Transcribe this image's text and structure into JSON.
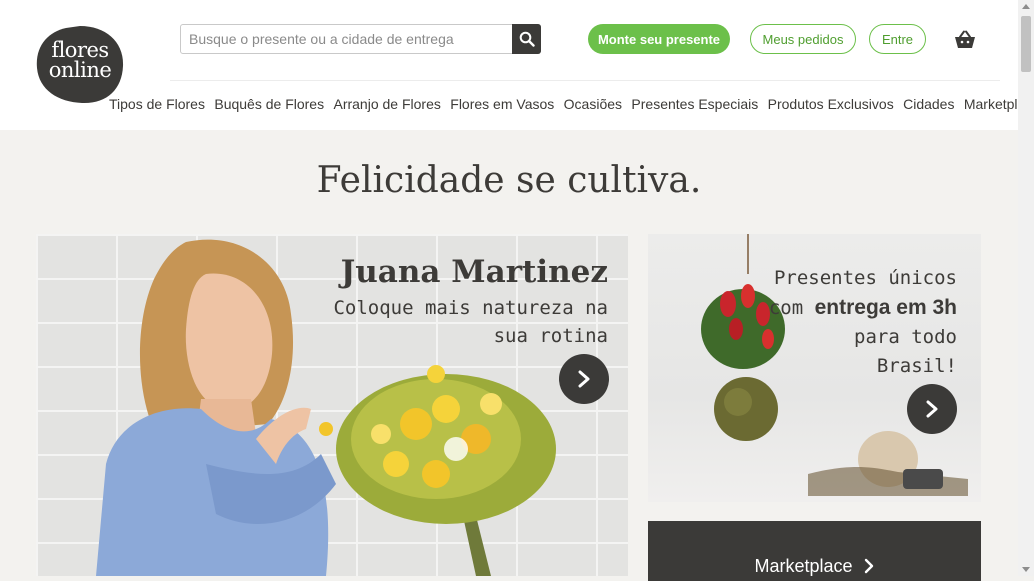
{
  "header": {
    "logo_text_line1": "flores",
    "logo_text_line2": "online",
    "search": {
      "placeholder": "Busque o presente ou a cidade de entrega"
    },
    "buttons": {
      "build_gift": "Monte seu presente",
      "my_orders": "Meus pedidos",
      "login": "Entre"
    },
    "nav": [
      "Tipos de Flores",
      "Buquês de Flores",
      "Arranjo de Flores",
      "Flores em Vasos",
      "Ocasiões",
      "Presentes Especiais",
      "Produtos Exclusivos",
      "Cidades",
      "Marketplace"
    ]
  },
  "main": {
    "headline": "Felicidade se cultiva.",
    "hero": {
      "title": "Juana Martinez",
      "subtitle": "Coloque mais natureza na sua rotina"
    },
    "promo": {
      "line1": "Presentes únicos",
      "line2_prefix": "com ",
      "line2_bold": "entrega em 3h",
      "line3": "para todo",
      "line4": "Brasil!"
    },
    "marketplace_label": "Marketplace"
  },
  "colors": {
    "brand_green": "#6cc04a",
    "dark": "#3b3a38",
    "background": "#f3f2ef"
  }
}
